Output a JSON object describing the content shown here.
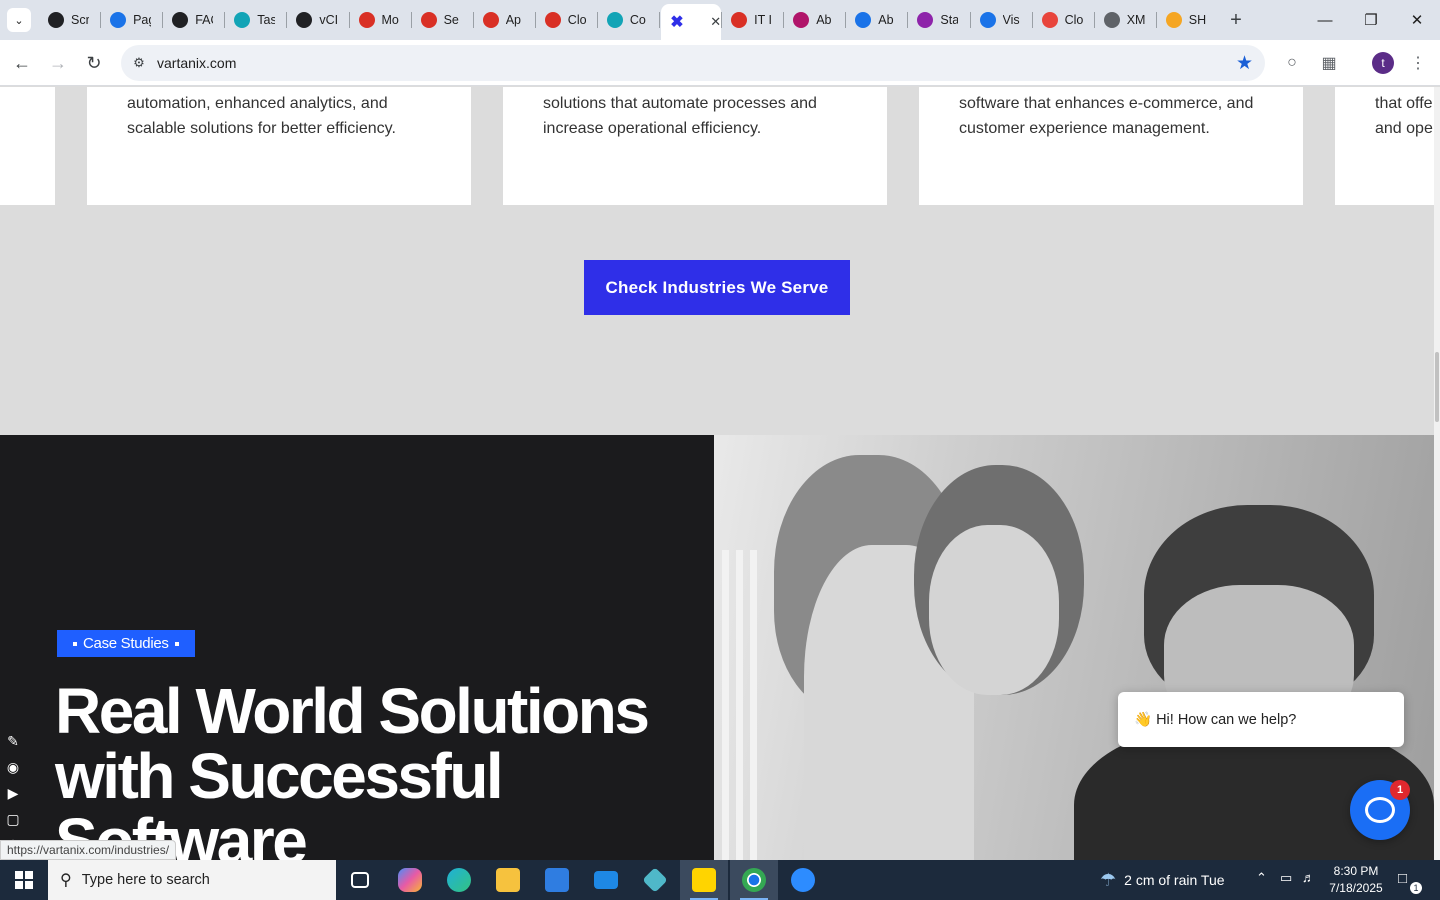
{
  "browser": {
    "tabs": [
      {
        "title": "Scr",
        "color": "#202124"
      },
      {
        "title": "Pag",
        "color": "#1a73e8"
      },
      {
        "title": "FAQ",
        "color": "#202124"
      },
      {
        "title": "Tas",
        "color": "#12a4b6"
      },
      {
        "title": "vCI",
        "color": "#202124"
      },
      {
        "title": "Mo",
        "color": "#d93025"
      },
      {
        "title": "Se",
        "color": "#d93025"
      },
      {
        "title": "Ap",
        "color": "#d93025"
      },
      {
        "title": "Clo",
        "color": "#d93025"
      },
      {
        "title": "Co",
        "color": "#12a4b6"
      },
      {
        "title": "",
        "color": "#2f2fe8",
        "active": true
      },
      {
        "title": "IT I",
        "color": "#d93025"
      },
      {
        "title": "Ab",
        "color": "#b0156a"
      },
      {
        "title": "Ab",
        "color": "#1a73e8"
      },
      {
        "title": "Sta",
        "color": "#8e24aa"
      },
      {
        "title": "Vis",
        "color": "#1a73e8"
      },
      {
        "title": "Clo",
        "color": "#e8453c"
      },
      {
        "title": "XM",
        "color": "#5f6368"
      },
      {
        "title": "SH",
        "color": "#f5a623"
      }
    ],
    "url": "vartanix.com",
    "profile_initial": "t",
    "status_url": "https://vartanix.com/industries/"
  },
  "cards": [
    {
      "text": ""
    },
    {
      "text": "automation, enhanced analytics, and scalable solutions for better efficiency."
    },
    {
      "text": "solutions that automate processes and increase operational efficiency."
    },
    {
      "text": "software that enhances e-commerce, and customer experience management."
    },
    {
      "text": "that offe and ope"
    }
  ],
  "cta_label": "Check Industries We Serve",
  "case_studies": {
    "badge": "Case Studies",
    "headline": "Real World Solutions with Successful Software"
  },
  "chat": {
    "greeting": "👋 Hi! How can we help?",
    "unread": "1"
  },
  "taskbar": {
    "search_placeholder": "Type here to search",
    "weather": "2 cm of rain Tue",
    "time": "8:30 PM",
    "date": "7/18/2025",
    "notifications": "1"
  },
  "colors": {
    "accent": "#2f2fe8",
    "badge": "#1f5fff",
    "dark_bg": "#1b1b1d",
    "chat": "#1a6ef5"
  }
}
